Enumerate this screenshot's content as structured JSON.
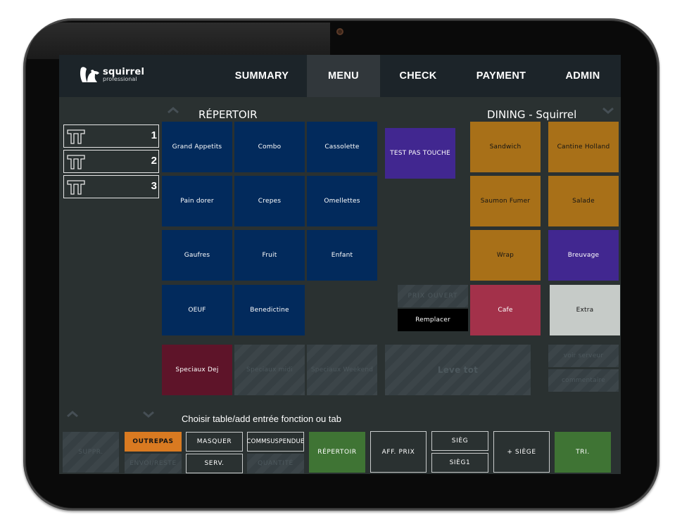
{
  "app": {
    "logo_name": "squirrel",
    "logo_sub": "professional"
  },
  "nav": {
    "tabs": [
      {
        "label": "SUMMARY",
        "active": false
      },
      {
        "label": "MENU",
        "active": true
      },
      {
        "label": "CHECK",
        "active": false
      },
      {
        "label": "PAYMENT",
        "active": false
      },
      {
        "label": "ADMIN",
        "active": false
      }
    ]
  },
  "headings": {
    "left": "RÉPERTOIR",
    "right": "DINING - Squirrel"
  },
  "tables": [
    {
      "number": "1",
      "icon": "table-icon"
    },
    {
      "number": "2",
      "icon": "table-icon"
    },
    {
      "number": "3",
      "icon": "table-icon"
    }
  ],
  "repertoire": {
    "tiles": [
      {
        "label": "Grand Appetits",
        "style": "blue"
      },
      {
        "label": "Combo",
        "style": "blue"
      },
      {
        "label": "Cassolette",
        "style": "blue"
      },
      {
        "label": "Pain dorer",
        "style": "blue"
      },
      {
        "label": "Crepes",
        "style": "blue"
      },
      {
        "label": "Omellettes",
        "style": "blue"
      },
      {
        "label": "Gaufres",
        "style": "blue"
      },
      {
        "label": "Fruit",
        "style": "blue"
      },
      {
        "label": "Enfant",
        "style": "blue"
      },
      {
        "label": "OEUF",
        "style": "blue"
      },
      {
        "label": "Benedictine",
        "style": "blue"
      }
    ],
    "specials": [
      {
        "label": "Speciaux Dej",
        "style": "maroon",
        "enabled": true
      },
      {
        "label": "Speciaux midi",
        "style": "disabled",
        "enabled": false
      },
      {
        "label": "Speciaux Weekend",
        "style": "disabled",
        "enabled": false
      }
    ]
  },
  "test_tile": {
    "label": "TEST PAS TOUCHE"
  },
  "dining": {
    "tiles": [
      {
        "label": "Sandwich",
        "style": "gold"
      },
      {
        "label": "Cantine Holland",
        "style": "gold"
      },
      {
        "label": "Saumon Fumer",
        "style": "gold"
      },
      {
        "label": "Salade",
        "style": "gold"
      },
      {
        "label": "Wrap",
        "style": "gold"
      },
      {
        "label": "Breuvage",
        "style": "purple"
      },
      {
        "label": "Cafe",
        "style": "red"
      },
      {
        "label": "Extra",
        "style": "light"
      }
    ]
  },
  "actions": {
    "prix_ouvert": "PRIX OUVERT",
    "remplacer": "Remplacer",
    "leve_tot": "Leve tot",
    "voir_serveur": "voir serveur",
    "commentaire": "commentaire"
  },
  "hint": "Choisir table/add  entrée  fonction ou tab",
  "bottom": {
    "suppr": "SUPPR.",
    "outrepas": "OUTREPAS",
    "envoi_reste": "ENVOI/RESTE",
    "masquer": "MASQUER",
    "serv": "SERV.",
    "commsuspendue": "COMMSUSPENDUE",
    "quantite": "QUANTITÉ",
    "repertoir": "RÉPERTOIR",
    "aff_prix": "AFF. PRIX",
    "sieg": "SIÈG",
    "sieg1": "SIÈG1",
    "plus_siege": "+ SIÈGE",
    "tri": "TRI."
  },
  "colors": {
    "nav_bg": "#1c2429",
    "nav_active": "#31373b",
    "screen_bg": "#2a3131",
    "blue_tile": "#022a5c",
    "gold_tile": "#a87018",
    "purple_tile": "#412790",
    "red_tile": "#a3314a",
    "maroon_tile": "#5e1429",
    "green_button": "#3f7434",
    "orange_button": "#d97a21"
  }
}
